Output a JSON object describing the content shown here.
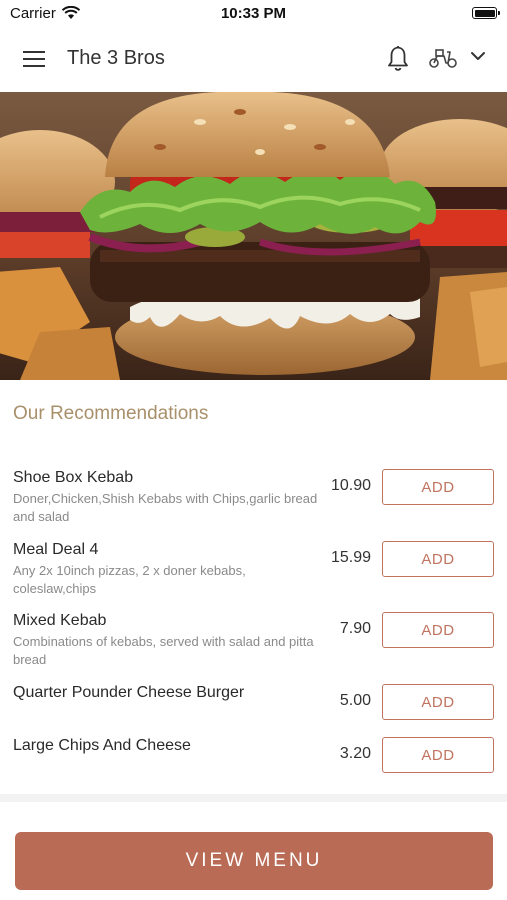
{
  "status": {
    "carrier": "Carrier",
    "time": "10:33 PM"
  },
  "header": {
    "title": "The 3 Bros"
  },
  "section": {
    "title": "Our Recommendations"
  },
  "items": [
    {
      "name": "Shoe Box Kebab",
      "desc": "Doner,Chicken,Shish Kebabs with Chips,garlic bread and salad",
      "price": "10.90",
      "button": "ADD"
    },
    {
      "name": "Meal Deal 4",
      "desc": "Any 2x 10inch pizzas, 2 x doner kebabs, coleslaw,chips",
      "price": "15.99",
      "button": "ADD"
    },
    {
      "name": "Mixed Kebab",
      "desc": "Combinations of kebabs, served with salad and pitta bread",
      "price": "7.90",
      "button": "ADD"
    },
    {
      "name": "Quarter Pounder Cheese Burger",
      "desc": "",
      "price": "5.00",
      "button": "ADD"
    },
    {
      "name": "Large Chips And Cheese",
      "desc": "",
      "price": "3.20",
      "button": "ADD"
    }
  ],
  "footer": {
    "button": "VIEW MENU"
  },
  "colors": {
    "accent": "#b96b55",
    "section_title": "#a8906a"
  },
  "icons": [
    "menu-icon",
    "bell-icon",
    "scooter-icon",
    "chevron-down-icon",
    "wifi-icon",
    "battery-icon"
  ]
}
